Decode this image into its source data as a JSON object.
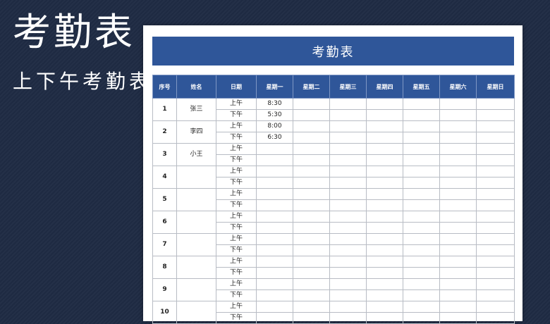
{
  "page": {
    "big_title": "考勤表",
    "sub_title": "上下午考勤表"
  },
  "sheet": {
    "title": "考勤表",
    "columns": [
      "序号",
      "姓名",
      "日期",
      "星期一",
      "星期二",
      "星期三",
      "星期四",
      "星期五",
      "星期六",
      "星期日"
    ],
    "periods": [
      "上午",
      "下午"
    ],
    "rows": [
      {
        "no": "1",
        "name": "张三",
        "am": [
          "8:30",
          "",
          "",
          "",
          "",
          "",
          ""
        ],
        "pm": [
          "5:30",
          "",
          "",
          "",
          "",
          "",
          ""
        ]
      },
      {
        "no": "2",
        "name": "李四",
        "am": [
          "8:00",
          "",
          "",
          "",
          "",
          "",
          ""
        ],
        "pm": [
          "6:30",
          "",
          "",
          "",
          "",
          "",
          ""
        ]
      },
      {
        "no": "3",
        "name": "小王",
        "am": [
          "",
          "",
          "",
          "",
          "",
          "",
          ""
        ],
        "pm": [
          "",
          "",
          "",
          "",
          "",
          "",
          ""
        ]
      },
      {
        "no": "4",
        "name": "",
        "am": [
          "",
          "",
          "",
          "",
          "",
          "",
          ""
        ],
        "pm": [
          "",
          "",
          "",
          "",
          "",
          "",
          ""
        ]
      },
      {
        "no": "5",
        "name": "",
        "am": [
          "",
          "",
          "",
          "",
          "",
          "",
          ""
        ],
        "pm": [
          "",
          "",
          "",
          "",
          "",
          "",
          ""
        ]
      },
      {
        "no": "6",
        "name": "",
        "am": [
          "",
          "",
          "",
          "",
          "",
          "",
          ""
        ],
        "pm": [
          "",
          "",
          "",
          "",
          "",
          "",
          ""
        ]
      },
      {
        "no": "7",
        "name": "",
        "am": [
          "",
          "",
          "",
          "",
          "",
          "",
          ""
        ],
        "pm": [
          "",
          "",
          "",
          "",
          "",
          "",
          ""
        ]
      },
      {
        "no": "8",
        "name": "",
        "am": [
          "",
          "",
          "",
          "",
          "",
          "",
          ""
        ],
        "pm": [
          "",
          "",
          "",
          "",
          "",
          "",
          ""
        ]
      },
      {
        "no": "9",
        "name": "",
        "am": [
          "",
          "",
          "",
          "",
          "",
          "",
          ""
        ],
        "pm": [
          "",
          "",
          "",
          "",
          "",
          "",
          ""
        ]
      },
      {
        "no": "10",
        "name": "",
        "am": [
          "",
          "",
          "",
          "",
          "",
          "",
          ""
        ],
        "pm": [
          "",
          "",
          "",
          "",
          "",
          "",
          ""
        ]
      }
    ]
  },
  "colors": {
    "background": "#1f2b44",
    "accent": "#2f5699",
    "grid_line": "#b8bcc4"
  }
}
